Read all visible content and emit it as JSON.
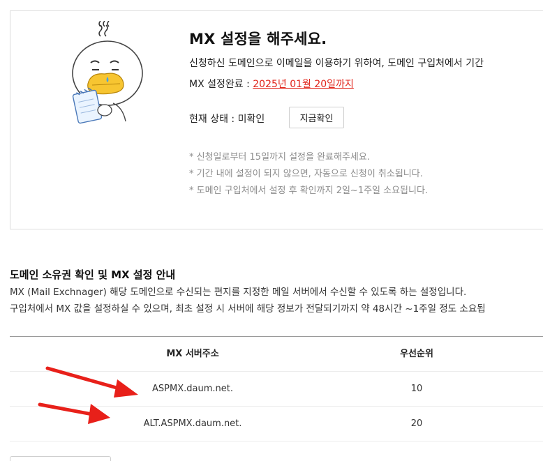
{
  "mx_box": {
    "title": "MX 설정을 해주세요.",
    "description": "신청하신 도메인으로 이메일을 이용하기 위하여, 도메인 구입처에서 기간",
    "deadline_label": "MX 설정완료 : ",
    "deadline_date": "2025년 01월 20일까지",
    "status_text": "현재 상태 : 미확인",
    "check_button": "지금확인",
    "notes": [
      "* 신청일로부터 15일까지 설정을 완료해주세요.",
      "* 기간 내에 설정이 되지 않으면, 자동으로 신청이 취소됩니다.",
      "* 도메인 구입처에서 설정 후 확인까지 2일~1주일 소요됩니다."
    ]
  },
  "guide": {
    "title": "도메인 소유권 확인 및 MX 설정 안내",
    "lines": [
      "MX (Mail Exchnager) 해당 도메인으로 수신되는 편지를 지정한 메일 서버에서 수신할 수 있도록 하는 설정입니다.",
      "구입처에서 MX 값을 설정하실 수 있으며, 최초 설정 시 서버에 해당 정보가 전달되기까지 약 48시간 ~1주일 정도 소요됩"
    ]
  },
  "table": {
    "headers": [
      "MX 서버주소",
      "우선순위"
    ],
    "rows": [
      [
        "ASPMX.daum.net.",
        "10"
      ],
      [
        "ALT.ASPMX.daum.net.",
        "20"
      ]
    ]
  },
  "colors": {
    "accent_red": "#e1251b",
    "arrow_red": "#e8201a"
  }
}
